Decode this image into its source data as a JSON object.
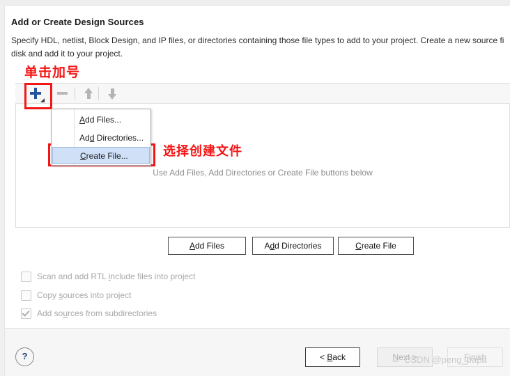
{
  "dialog": {
    "title": "Add or Create Design Sources",
    "description_line1": "Specify HDL, netlist, Block Design, and IP files, or directories containing those file types to add to your project. Create a new source fi",
    "description_line2": "disk and add it to your project."
  },
  "annotations": {
    "click_plus": "单击加号",
    "choose_create_file": "选择创建文件",
    "box_color": "#f21616"
  },
  "toolbar": {
    "add_icon": "plus-icon",
    "remove_icon": "minus-icon",
    "move_up_icon": "arrow-up-icon",
    "move_down_icon": "arrow-down-icon",
    "add_icon_color": "#26539b",
    "disabled_icon_color": "#b4b4b4"
  },
  "menu": {
    "items": [
      {
        "prefix": "",
        "mnemonic": "A",
        "suffix": "dd Files...",
        "selected": false
      },
      {
        "prefix": "Ad",
        "mnemonic": "d",
        "suffix": " Directories...",
        "selected": false
      },
      {
        "prefix": "",
        "mnemonic": "C",
        "suffix": "reate File...",
        "selected": true
      }
    ],
    "selected_bg": "#cfe0f7"
  },
  "list_panel": {
    "empty_text": "Use Add Files, Add Directories or Create File buttons below"
  },
  "action_buttons": [
    {
      "prefix": "",
      "mnemonic": "A",
      "suffix": "dd Files"
    },
    {
      "prefix": "A",
      "mnemonic": "d",
      "suffix": "d Directories"
    },
    {
      "prefix": "",
      "mnemonic": "C",
      "suffix": "reate File"
    }
  ],
  "options": [
    {
      "prefix": "Scan and add RTL ",
      "mnemonic": "i",
      "suffix": "nclude files into project",
      "checked": false,
      "enabled": false
    },
    {
      "prefix": "Copy ",
      "mnemonic": "s",
      "suffix": "ources into project",
      "checked": false,
      "enabled": false
    },
    {
      "prefix": "Add so",
      "mnemonic": "u",
      "suffix": "rces from subdirectories",
      "checked": true,
      "enabled": false
    }
  ],
  "footer": {
    "help_label": "?",
    "back": {
      "prefix": "< ",
      "mnemonic": "B",
      "suffix": "ack",
      "enabled": true
    },
    "next": {
      "prefix": "",
      "mnemonic": "N",
      "suffix": "ext >",
      "enabled": false
    },
    "finish": {
      "prefix": "",
      "mnemonic": "F",
      "suffix": "inish",
      "enabled": false
    }
  },
  "watermark": "CSDN @peng_papa"
}
